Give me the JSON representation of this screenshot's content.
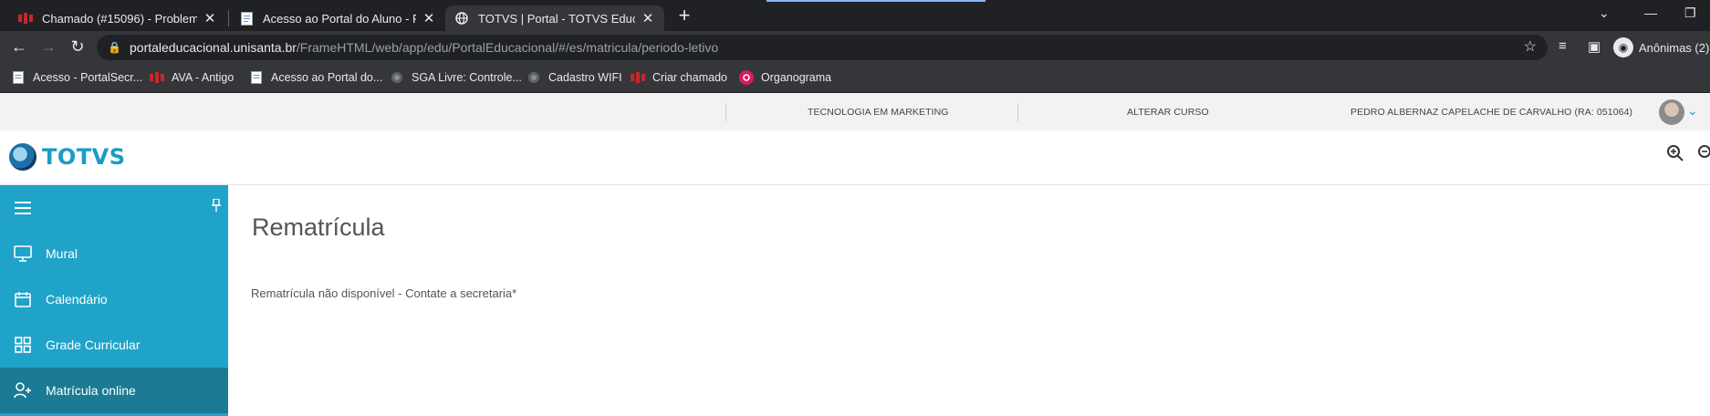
{
  "browser": {
    "tabs": [
      {
        "title": "Chamado (#15096) - Problemas c",
        "active": false
      },
      {
        "title": "Acesso ao Portal do Aluno - Porta",
        "active": false
      },
      {
        "title": "TOTVS | Portal - TOTVS Educacion",
        "active": true
      }
    ],
    "url_domain": "portaleducacional.unisanta.br",
    "url_path": "/FrameHTML/web/app/edu/PortalEducacional/#/es/matricula/periodo-letivo",
    "profile_label": "Anônimas (2)",
    "bookmarks": [
      {
        "label": "Acesso - PortalSecr...",
        "icon": "document-icon"
      },
      {
        "label": "AVA - Antigo",
        "icon": "unisanta-icon"
      },
      {
        "label": "Acesso ao Portal do...",
        "icon": "document-icon"
      },
      {
        "label": "SGA Livre: Controle...",
        "icon": "globe-icon"
      },
      {
        "label": "Cadastro WIFI",
        "icon": "globe-icon"
      },
      {
        "label": "Criar chamado",
        "icon": "unisanta-icon"
      },
      {
        "label": "Organograma",
        "icon": "organograma-icon"
      }
    ]
  },
  "portal_bar": {
    "course": "TECNOLOGIA EM MARKETING",
    "change_course": "ALTERAR CURSO",
    "user": "PEDRO ALBERNAZ CAPELACHE DE CARVALHO (RA: 051064)"
  },
  "logo": {
    "text": "TOTVS"
  },
  "sidebar": {
    "items": [
      {
        "label": "Mural",
        "icon": "monitor-icon",
        "active": false
      },
      {
        "label": "Calendário",
        "icon": "calendar-icon",
        "active": false
      },
      {
        "label": "Grade Curricular",
        "icon": "grid-icon",
        "active": false
      },
      {
        "label": "Matrícula online",
        "icon": "user-plus-icon",
        "active": true
      }
    ]
  },
  "main": {
    "title": "Rematrícula",
    "message": "Rematrícula não disponível - Contate a secretaria*"
  },
  "colors": {
    "sidebar": "#1fa3c9",
    "sidebar_active": "#1b7a94",
    "brand": "#1a9cc7"
  }
}
